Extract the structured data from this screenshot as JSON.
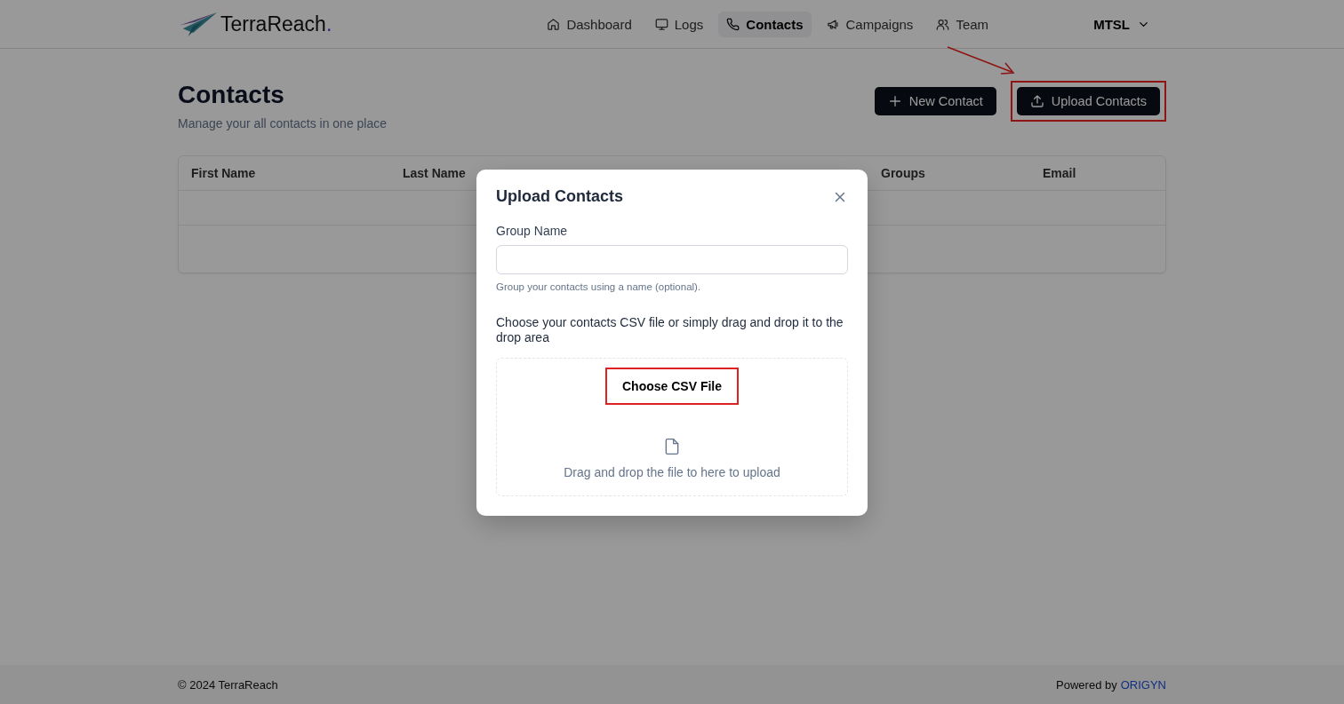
{
  "header": {
    "logo_text": "TerraReach",
    "logo_dot": ".",
    "nav": [
      {
        "label": "Dashboard",
        "kind": "home",
        "selected": false
      },
      {
        "label": "Logs",
        "kind": "monitor",
        "selected": false
      },
      {
        "label": "Contacts",
        "kind": "phone",
        "selected": true
      },
      {
        "label": "Campaigns",
        "kind": "megaphone",
        "selected": false
      },
      {
        "label": "Team",
        "kind": "users",
        "selected": false
      }
    ],
    "account": "MTSL"
  },
  "page": {
    "title": "Contacts",
    "subtitle": "Manage your all contacts in one place",
    "actions": [
      {
        "label": "New Contact",
        "kind": "plus",
        "highlighted": false
      },
      {
        "label": "Upload Contacts",
        "kind": "upload",
        "highlighted": true
      }
    ]
  },
  "table": {
    "columns": [
      "First Name",
      "Last Name",
      "Groups",
      "Email"
    ]
  },
  "dialog": {
    "title": "Upload Contacts",
    "field_label": "Group Name",
    "field_hint": "Group your contacts using a name (optional).",
    "instructions": "Choose your contacts CSV file or simply drag and drop it to the drop area",
    "choose_button": {
      "label": "Choose CSV File",
      "highlighted": true
    },
    "drop_text": "Drag and drop the file to here to upload"
  },
  "footer": {
    "copyright": "© 2024 TerraReach",
    "powered_by": "Powered by",
    "link": "ORIGYN"
  }
}
